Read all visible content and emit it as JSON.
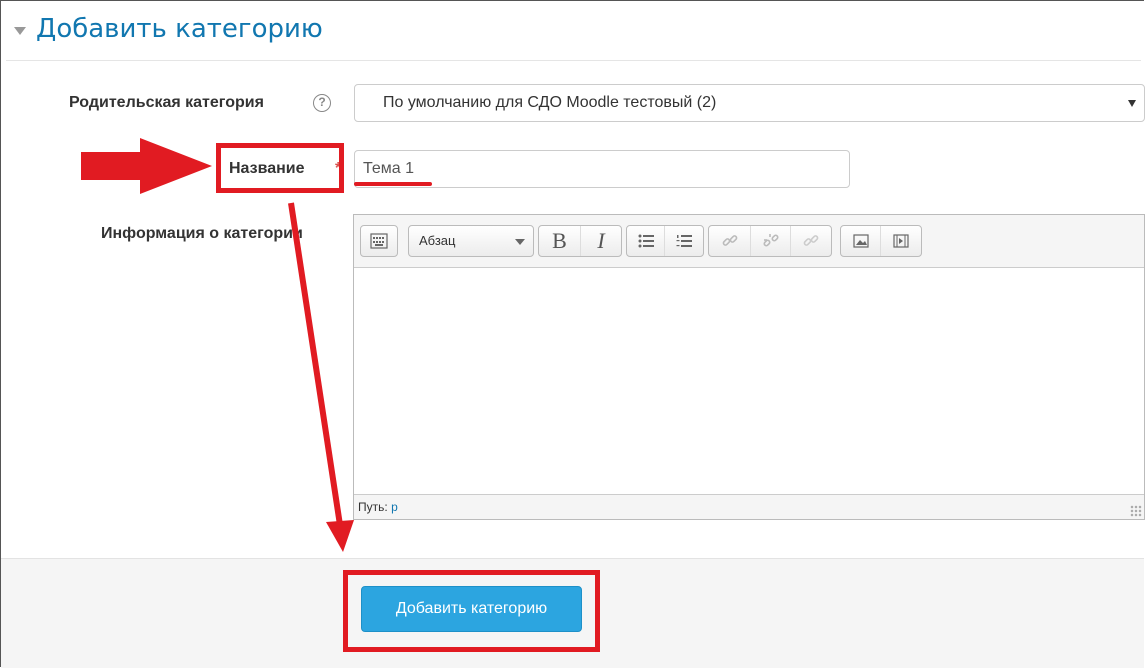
{
  "section": {
    "title": "Добавить категорию"
  },
  "form": {
    "parent_label": "Родительская категория",
    "parent_value": "По умолчанию для СДО Moodle тестовый (2)",
    "help_glyph": "?",
    "name_label": "Название",
    "required_marker": "*",
    "name_value": "Тема 1",
    "description_label": "Информация о категории"
  },
  "editor": {
    "format_value": "Абзац",
    "bold_label": "B",
    "italic_label": "I",
    "path_label": "Путь:",
    "path_value": "p",
    "toolbar_icons": [
      "toolbar-toggle-icon",
      "unordered-list-icon",
      "ordered-list-icon",
      "link-icon",
      "unlink-icon",
      "anchor-icon",
      "image-icon",
      "media-icon"
    ]
  },
  "footer": {
    "submit_label": "Добавить категорию"
  },
  "colors": {
    "accent": "#1177b0",
    "button": "#2ca5e0",
    "annotation": "#e11b22",
    "required": "#d9534f"
  }
}
